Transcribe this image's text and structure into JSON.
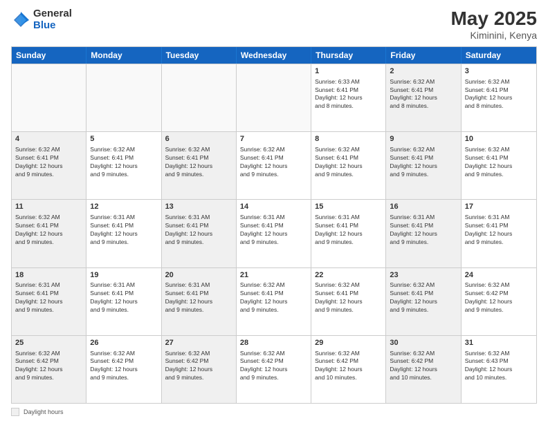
{
  "logo": {
    "general": "General",
    "blue": "Blue"
  },
  "header": {
    "month": "May 2025",
    "location": "Kiminini, Kenya"
  },
  "days_of_week": [
    "Sunday",
    "Monday",
    "Tuesday",
    "Wednesday",
    "Thursday",
    "Friday",
    "Saturday"
  ],
  "weeks": [
    [
      {
        "day": "",
        "info": "",
        "empty": true
      },
      {
        "day": "",
        "info": "",
        "empty": true
      },
      {
        "day": "",
        "info": "",
        "empty": true
      },
      {
        "day": "",
        "info": "",
        "empty": true
      },
      {
        "day": "1",
        "info": "Sunrise: 6:33 AM\nSunset: 6:41 PM\nDaylight: 12 hours\nand 8 minutes.",
        "shaded": false
      },
      {
        "day": "2",
        "info": "Sunrise: 6:32 AM\nSunset: 6:41 PM\nDaylight: 12 hours\nand 8 minutes.",
        "shaded": true
      },
      {
        "day": "3",
        "info": "Sunrise: 6:32 AM\nSunset: 6:41 PM\nDaylight: 12 hours\nand 8 minutes.",
        "shaded": false
      }
    ],
    [
      {
        "day": "4",
        "info": "Sunrise: 6:32 AM\nSunset: 6:41 PM\nDaylight: 12 hours\nand 9 minutes.",
        "shaded": true
      },
      {
        "day": "5",
        "info": "Sunrise: 6:32 AM\nSunset: 6:41 PM\nDaylight: 12 hours\nand 9 minutes.",
        "shaded": false
      },
      {
        "day": "6",
        "info": "Sunrise: 6:32 AM\nSunset: 6:41 PM\nDaylight: 12 hours\nand 9 minutes.",
        "shaded": true
      },
      {
        "day": "7",
        "info": "Sunrise: 6:32 AM\nSunset: 6:41 PM\nDaylight: 12 hours\nand 9 minutes.",
        "shaded": false
      },
      {
        "day": "8",
        "info": "Sunrise: 6:32 AM\nSunset: 6:41 PM\nDaylight: 12 hours\nand 9 minutes.",
        "shaded": false
      },
      {
        "day": "9",
        "info": "Sunrise: 6:32 AM\nSunset: 6:41 PM\nDaylight: 12 hours\nand 9 minutes.",
        "shaded": true
      },
      {
        "day": "10",
        "info": "Sunrise: 6:32 AM\nSunset: 6:41 PM\nDaylight: 12 hours\nand 9 minutes.",
        "shaded": false
      }
    ],
    [
      {
        "day": "11",
        "info": "Sunrise: 6:32 AM\nSunset: 6:41 PM\nDaylight: 12 hours\nand 9 minutes.",
        "shaded": true
      },
      {
        "day": "12",
        "info": "Sunrise: 6:31 AM\nSunset: 6:41 PM\nDaylight: 12 hours\nand 9 minutes.",
        "shaded": false
      },
      {
        "day": "13",
        "info": "Sunrise: 6:31 AM\nSunset: 6:41 PM\nDaylight: 12 hours\nand 9 minutes.",
        "shaded": true
      },
      {
        "day": "14",
        "info": "Sunrise: 6:31 AM\nSunset: 6:41 PM\nDaylight: 12 hours\nand 9 minutes.",
        "shaded": false
      },
      {
        "day": "15",
        "info": "Sunrise: 6:31 AM\nSunset: 6:41 PM\nDaylight: 12 hours\nand 9 minutes.",
        "shaded": false
      },
      {
        "day": "16",
        "info": "Sunrise: 6:31 AM\nSunset: 6:41 PM\nDaylight: 12 hours\nand 9 minutes.",
        "shaded": true
      },
      {
        "day": "17",
        "info": "Sunrise: 6:31 AM\nSunset: 6:41 PM\nDaylight: 12 hours\nand 9 minutes.",
        "shaded": false
      }
    ],
    [
      {
        "day": "18",
        "info": "Sunrise: 6:31 AM\nSunset: 6:41 PM\nDaylight: 12 hours\nand 9 minutes.",
        "shaded": true
      },
      {
        "day": "19",
        "info": "Sunrise: 6:31 AM\nSunset: 6:41 PM\nDaylight: 12 hours\nand 9 minutes.",
        "shaded": false
      },
      {
        "day": "20",
        "info": "Sunrise: 6:31 AM\nSunset: 6:41 PM\nDaylight: 12 hours\nand 9 minutes.",
        "shaded": true
      },
      {
        "day": "21",
        "info": "Sunrise: 6:32 AM\nSunset: 6:41 PM\nDaylight: 12 hours\nand 9 minutes.",
        "shaded": false
      },
      {
        "day": "22",
        "info": "Sunrise: 6:32 AM\nSunset: 6:41 PM\nDaylight: 12 hours\nand 9 minutes.",
        "shaded": false
      },
      {
        "day": "23",
        "info": "Sunrise: 6:32 AM\nSunset: 6:41 PM\nDaylight: 12 hours\nand 9 minutes.",
        "shaded": true
      },
      {
        "day": "24",
        "info": "Sunrise: 6:32 AM\nSunset: 6:42 PM\nDaylight: 12 hours\nand 9 minutes.",
        "shaded": false
      }
    ],
    [
      {
        "day": "25",
        "info": "Sunrise: 6:32 AM\nSunset: 6:42 PM\nDaylight: 12 hours\nand 9 minutes.",
        "shaded": true
      },
      {
        "day": "26",
        "info": "Sunrise: 6:32 AM\nSunset: 6:42 PM\nDaylight: 12 hours\nand 9 minutes.",
        "shaded": false
      },
      {
        "day": "27",
        "info": "Sunrise: 6:32 AM\nSunset: 6:42 PM\nDaylight: 12 hours\nand 9 minutes.",
        "shaded": true
      },
      {
        "day": "28",
        "info": "Sunrise: 6:32 AM\nSunset: 6:42 PM\nDaylight: 12 hours\nand 9 minutes.",
        "shaded": false
      },
      {
        "day": "29",
        "info": "Sunrise: 6:32 AM\nSunset: 6:42 PM\nDaylight: 12 hours\nand 10 minutes.",
        "shaded": false
      },
      {
        "day": "30",
        "info": "Sunrise: 6:32 AM\nSunset: 6:42 PM\nDaylight: 12 hours\nand 10 minutes.",
        "shaded": true
      },
      {
        "day": "31",
        "info": "Sunrise: 6:32 AM\nSunset: 6:43 PM\nDaylight: 12 hours\nand 10 minutes.",
        "shaded": false
      }
    ]
  ],
  "footer": {
    "label": "Daylight hours"
  }
}
